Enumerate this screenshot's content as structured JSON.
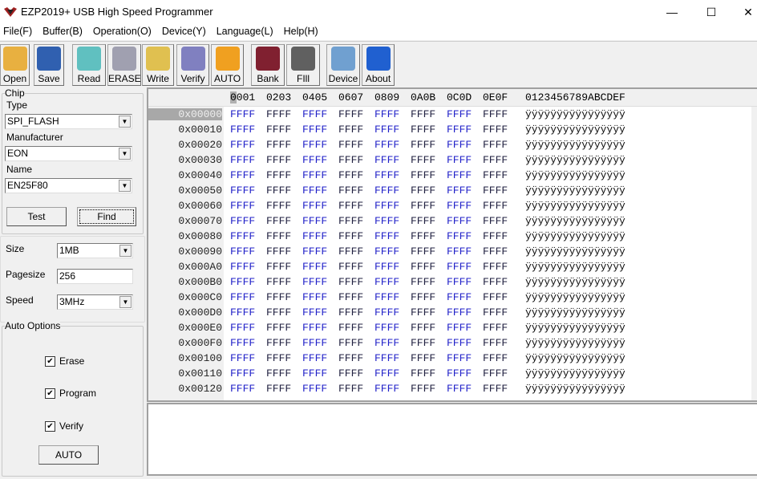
{
  "window": {
    "title": "EZP2019+ USB High Speed Programmer",
    "minimize": "—",
    "maximize": "☐",
    "close": "✕"
  },
  "menu": [
    "File(F)",
    "Buffer(B)",
    "Operation(O)",
    "Device(Y)",
    "Language(L)",
    "Help(H)"
  ],
  "toolbar": [
    {
      "label": "Open",
      "icon": "folder-open-icon",
      "color": "#e8b040"
    },
    {
      "label": "Save",
      "icon": "floppy-disk-icon",
      "color": "#3060b0"
    },
    {
      "label": "Read",
      "icon": "notepad-icon",
      "color": "#60c0c0"
    },
    {
      "label": "ERASE",
      "icon": "trash-can-icon",
      "color": "#a0a0b0"
    },
    {
      "label": "Write",
      "icon": "folder-arrow-icon",
      "color": "#e0c050"
    },
    {
      "label": "Verify",
      "icon": "magnifier-icon",
      "color": "#8080c0"
    },
    {
      "label": "AUTO",
      "icon": "running-man-icon",
      "color": "#f0a020"
    },
    {
      "label": "Bank",
      "icon": "chip-info-icon",
      "color": "#802030"
    },
    {
      "label": "FIll",
      "icon": "bucket-icon",
      "color": "#606060"
    },
    {
      "label": "Device",
      "icon": "gear-device-icon",
      "color": "#70a0d0"
    },
    {
      "label": "About",
      "icon": "help-question-icon",
      "color": "#2060d0"
    }
  ],
  "chip": {
    "group": "Chip",
    "type_label": "Type",
    "type": "SPI_FLASH",
    "manufacturer_label": "Manufacturer",
    "manufacturer": "EON",
    "name_label": "Name",
    "name": "EN25F80",
    "test": "Test",
    "find": "Find"
  },
  "params": {
    "size_label": "Size",
    "size": "1MB",
    "pagesize_label": "Pagesize",
    "pagesize": "256",
    "speed_label": "Speed",
    "speed": "3MHz"
  },
  "auto_options": {
    "group": "Auto Options",
    "erase": "Erase",
    "erase_checked": true,
    "program": "Program",
    "program_checked": true,
    "verify": "Verify",
    "verify_checked": true,
    "auto": "AUTO"
  },
  "hex": {
    "columns": [
      "0001",
      "0203",
      "0405",
      "0607",
      "0809",
      "0A0B",
      "0C0D",
      "0E0F"
    ],
    "ascii_header": "0123456789ABCDEF",
    "selected_row": "0x00000",
    "rows": [
      "0x00000",
      "0x00010",
      "0x00020",
      "0x00030",
      "0x00040",
      "0x00050",
      "0x00060",
      "0x00070",
      "0x00080",
      "0x00090",
      "0x000A0",
      "0x000B0",
      "0x000C0",
      "0x000D0",
      "0x000E0",
      "0x000F0",
      "0x00100",
      "0x00110",
      "0x00120"
    ],
    "cell_value": "FFFF",
    "ascii_value": "ÿÿÿÿÿÿÿÿÿÿÿÿÿÿÿÿ"
  },
  "log": ""
}
